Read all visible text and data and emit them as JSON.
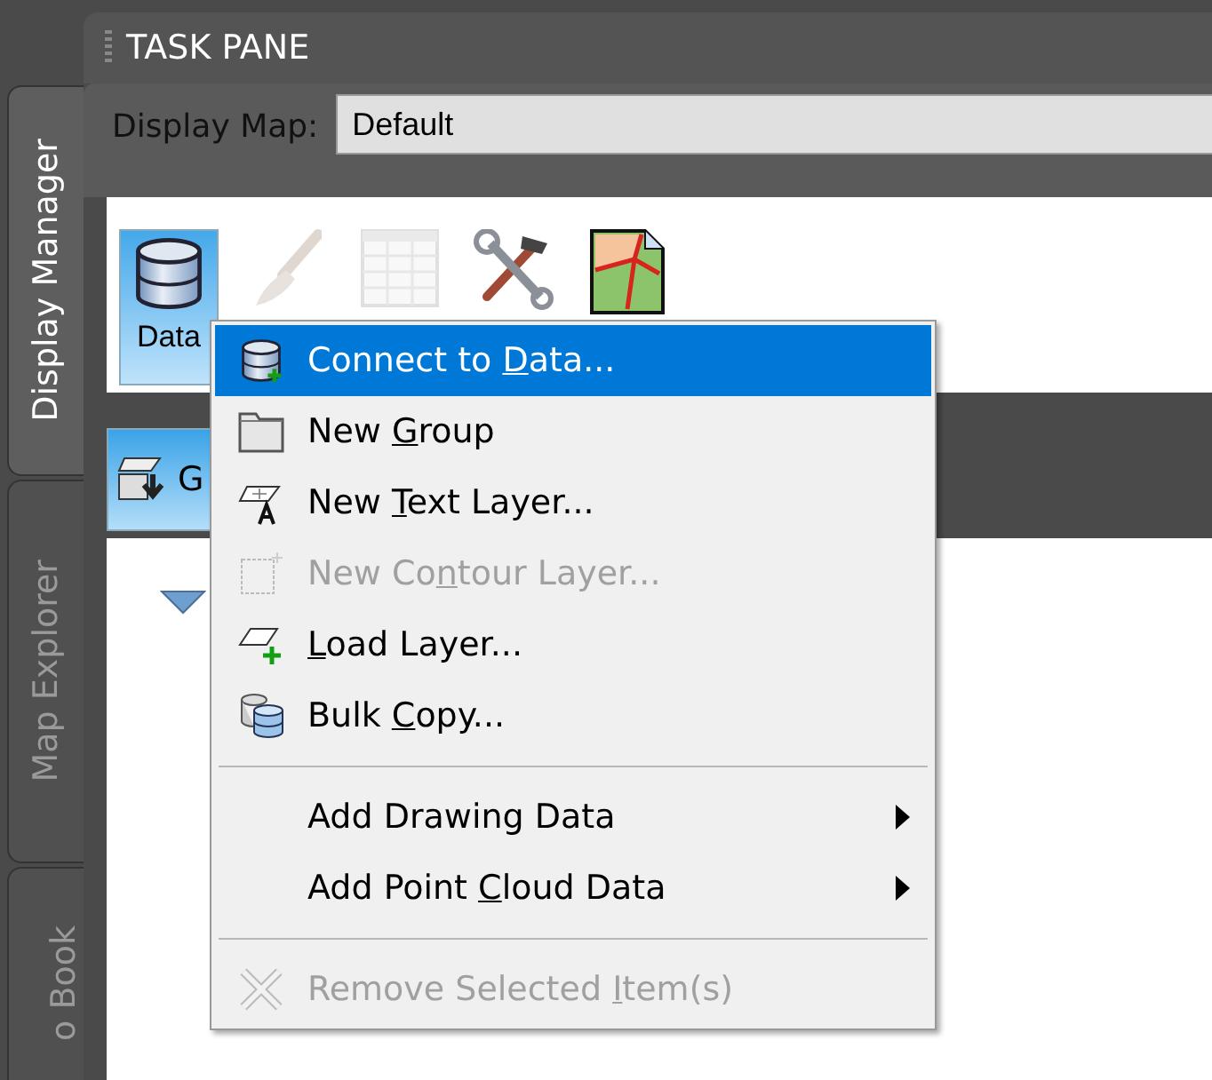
{
  "side_tabs": [
    {
      "label": "Display Manager",
      "selected": true
    },
    {
      "label": "Map Explorer",
      "selected": false
    },
    {
      "label": "o Book",
      "selected": false
    }
  ],
  "pane": {
    "title": "TASK PANE",
    "display_map": {
      "label": "Display Map:",
      "value": "Default"
    }
  },
  "toolbar": [
    {
      "label": "Data",
      "selected": true,
      "disabled": false
    },
    {
      "selected": false,
      "disabled": true
    },
    {
      "selected": false,
      "disabled": true
    },
    {
      "selected": false,
      "disabled": false
    },
    {
      "selected": false,
      "disabled": false
    }
  ],
  "group_button": {
    "label": "G"
  },
  "context_menu": [
    {
      "kind": "item",
      "before": "Connect to ",
      "key": "D",
      "after": "ata...",
      "selected": true,
      "disabled": false,
      "submenu": false
    },
    {
      "kind": "item",
      "before": "New ",
      "key": "G",
      "after": "roup",
      "selected": false,
      "disabled": false,
      "submenu": false
    },
    {
      "kind": "item",
      "before": "New ",
      "key": "T",
      "after": "ext Layer...",
      "selected": false,
      "disabled": false,
      "submenu": false
    },
    {
      "kind": "item",
      "before": "New Co",
      "key": "n",
      "after": "tour Layer...",
      "selected": false,
      "disabled": true,
      "submenu": false
    },
    {
      "kind": "item",
      "key": "L",
      "after": "oad Layer...",
      "selected": false,
      "disabled": false,
      "submenu": false
    },
    {
      "kind": "item",
      "before": "Bulk ",
      "key": "C",
      "after": "opy...",
      "selected": false,
      "disabled": false,
      "submenu": false
    },
    {
      "kind": "separator"
    },
    {
      "kind": "item",
      "before": "Add Drawing Data",
      "selected": false,
      "disabled": false,
      "submenu": true
    },
    {
      "kind": "item",
      "before": "Add Point ",
      "key": "C",
      "after": "loud Data",
      "selected": false,
      "disabled": false,
      "submenu": true
    },
    {
      "kind": "separator"
    },
    {
      "kind": "item",
      "before": "Remove Selected ",
      "key": "I",
      "after": "tem(s)",
      "selected": false,
      "disabled": true,
      "submenu": false
    }
  ]
}
